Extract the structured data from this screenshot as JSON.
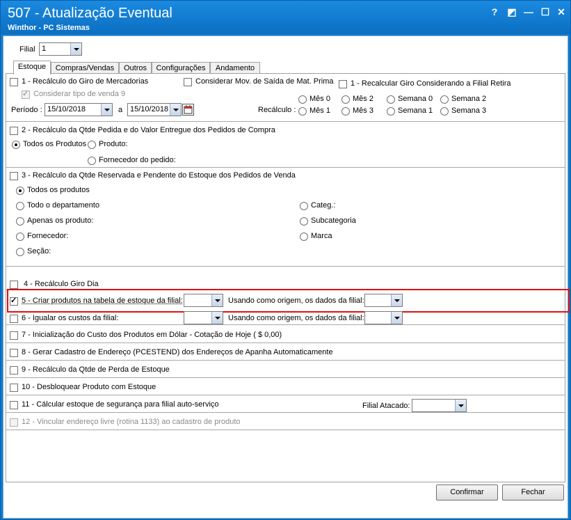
{
  "window": {
    "title": "507 - Atualização Eventual",
    "subtitle": "Winthor - PC Sistemas",
    "controls": [
      "?",
      "◩",
      "—",
      "☐",
      "✕"
    ]
  },
  "filial": {
    "label": "Filial",
    "value": "1"
  },
  "tabs": [
    {
      "label": "Estoque",
      "active": true
    },
    {
      "label": "Compras/Vendas"
    },
    {
      "label": "Outros"
    },
    {
      "label": "Configurações"
    },
    {
      "label": "Andamento"
    }
  ],
  "sec1": {
    "recalc_giro_label": "1 - Recálculo do Giro de Mercadorias",
    "considerar_mov_label": "Considerar Mov. de Saída de Mat. Prima",
    "recalc_filial_retira_label": "1 - Recalcular Giro Considerando a Filial Retira",
    "considerar_tipo_venda_label": "Considerar tipo de venda 9",
    "periodo_label": "Período :",
    "date_from": "15/10/2018",
    "a_label": "a",
    "date_to": "15/10/2018",
    "recalculo_label": "Recálculo :",
    "radios": [
      "Mês 0",
      "Mês 2",
      "Semana 0",
      "Semana 2",
      "Mês 1",
      "Mês 3",
      "Semana 1",
      "Semana 3"
    ]
  },
  "sec2": {
    "label": "2 - Recálculo da Qtde Pedida e do Valor Entregue dos Pedidos de Compra",
    "todos": "Todos os Produtos",
    "produto": "Produto:",
    "fornecedor": "Fornecedor do pedido:"
  },
  "sec3": {
    "label": "3 - Recálculo da Qtde Reservada e Pendente do Estoque dos Pedidos de Venda",
    "todos": "Todos os produtos",
    "departamento": "Todo o departamento",
    "apenas": "Apenas os produto:",
    "fornecedor": "Fornecedor:",
    "secao": "Seção:",
    "categ": "Categ.:",
    "subcategoria": "Subcategoria",
    "marca": "Marca"
  },
  "sec4": {
    "label": "4 - Recálculo Giro Dia"
  },
  "sec5": {
    "label": "5 - Criar produtos na tabela de estoque da filial:",
    "origem_label": "Usando como origem, os dados da filial:"
  },
  "sec6": {
    "label": "6 - Igualar os custos da filial:",
    "origem_label": "Usando como origem, os dados da filial:"
  },
  "sec7": {
    "label": "7 - Inicialização do Custo dos Produtos em Dólar - Cotação de Hoje ( $ 0,00)"
  },
  "sec8": {
    "label": "8 - Gerar Cadastro de Endereço (PCESTEND) dos Endereços de Apanha Automaticamente"
  },
  "sec9": {
    "label": "9 - Recálculo da Qtde de Perda de Estoque"
  },
  "sec10": {
    "label": "10 - Desbloquear Produto com Estoque"
  },
  "sec11": {
    "label": "11 - Cálcular estoque de segurança para filial auto-serviço",
    "filial_atacado_label": "Filial Atacado:"
  },
  "sec12": {
    "label": "12 - Vincular endereço livre (rotina 1133) ao cadastro de produto"
  },
  "buttons": {
    "confirmar": "Confirmar",
    "fechar": "Fechar"
  },
  "colors": {
    "title_bar": "#0c6fc2",
    "highlight": "#e01010"
  }
}
